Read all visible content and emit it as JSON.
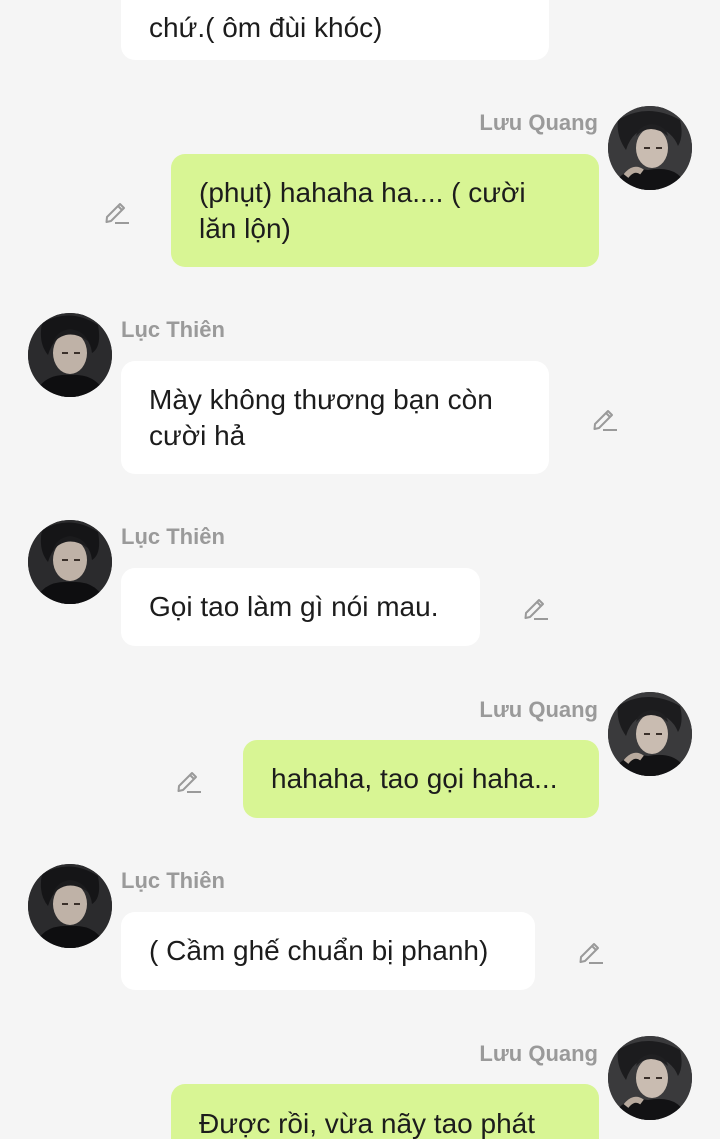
{
  "chat": {
    "m0": {
      "text": "chứ.( ôm đùi khóc)"
    },
    "m1": {
      "sender": "Lưu Quang",
      "text": "(phụt) hahaha ha.... ( cười\nlăn lộn)"
    },
    "m2": {
      "sender": "Lục Thiên",
      "text": "Mày không thương bạn còn\ncười hả"
    },
    "m3": {
      "sender": "Lục Thiên",
      "text": "Gọi tao làm gì nói mau."
    },
    "m4": {
      "sender": "Lưu Quang",
      "text": "hahaha, tao gọi haha..."
    },
    "m5": {
      "sender": "Lục Thiên",
      "text": "( Cầm ghế chuẩn bị phanh)"
    },
    "m6": {
      "sender": "Lưu Quang",
      "text": "Được rồi, vừa nãy tao phát"
    }
  },
  "colors": {
    "background": "#f5f5f5",
    "bubble_left": "#ffffff",
    "bubble_right": "#d8f594",
    "name": "#9a9a9a"
  },
  "icons": {
    "edit": "pencil-edit-icon"
  }
}
